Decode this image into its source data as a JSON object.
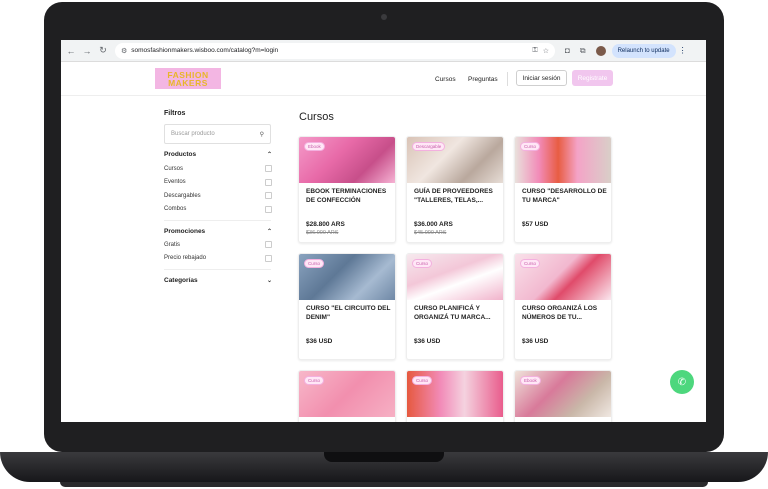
{
  "browser": {
    "url": "somosfashionmakers.wisboo.com/catalog?m=login",
    "relaunch_label": "Relaunch to update"
  },
  "site": {
    "logo_line1": "FASHION",
    "logo_line2": "MAKERS",
    "nav": [
      "Cursos",
      "Preguntas"
    ],
    "login_label": "Iniciar sesión",
    "register_label": "Registrate"
  },
  "filters": {
    "title": "Filtros",
    "search_placeholder": "Buscar producto",
    "productos_label": "Productos",
    "productos_options": [
      "Cursos",
      "Eventos",
      "Descargables",
      "Combos"
    ],
    "promociones_label": "Promociones",
    "promociones_options": [
      "Gratis",
      "Precio rebajado"
    ],
    "categorias_label": "Categorías"
  },
  "main": {
    "title": "Cursos",
    "cards": [
      {
        "tag": "Ebook",
        "title": "EBOOK TERMINACIONES DE CONFECCIÓN",
        "price": "$28.800 ARS",
        "old_price": "$36.000 ARS"
      },
      {
        "tag": "Descargable",
        "title": "GUÍA DE PROVEEDORES \"TALLERES, TELAS,...",
        "price": "$36.000 ARS",
        "old_price": "$45.000 ARS"
      },
      {
        "tag": "Curso",
        "title": "CURSO \"DESARROLLO DE TU MARCA\"",
        "price": "$57 USD",
        "old_price": ""
      },
      {
        "tag": "Curso",
        "title": "CURSO \"EL CIRCUITO DEL DENIM\"",
        "price": "$36 USD",
        "old_price": ""
      },
      {
        "tag": "Curso",
        "title": "CURSO PLANIFICÁ Y ORGANIZÁ TU MARCA...",
        "price": "$36 USD",
        "old_price": ""
      },
      {
        "tag": "Curso",
        "title": "CURSO ORGANIZÁ LOS NÚMEROS DE TU...",
        "price": "$36 USD",
        "old_price": ""
      },
      {
        "tag": "Curso",
        "title": "",
        "price": "",
        "old_price": ""
      },
      {
        "tag": "Curso",
        "title": "",
        "price": "",
        "old_price": ""
      },
      {
        "tag": "Ebook",
        "title": "",
        "price": "",
        "old_price": ""
      }
    ]
  },
  "colors": {
    "accent_pink": "#f1c6ee",
    "whatsapp": "#4dd77d",
    "logo_bg": "#f3b6e3",
    "logo_text": "#e8b62a"
  }
}
